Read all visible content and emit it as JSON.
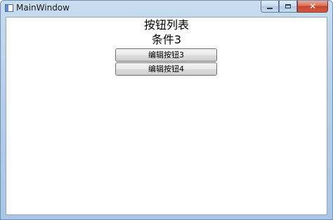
{
  "window": {
    "title": "MainWindow",
    "caption_buttons": {
      "minimize_icon": "minimize-icon",
      "maximize_icon": "maximize-icon",
      "close_label": "✕"
    }
  },
  "content": {
    "heading": "按钮列表",
    "condition": "条件3",
    "buttons": [
      {
        "label": "编辑按钮3"
      },
      {
        "label": "编辑按钮4"
      }
    ]
  },
  "colors": {
    "frame": "#b7cfe9",
    "close_button": "#c6452a",
    "client_background": "#ffffff"
  }
}
